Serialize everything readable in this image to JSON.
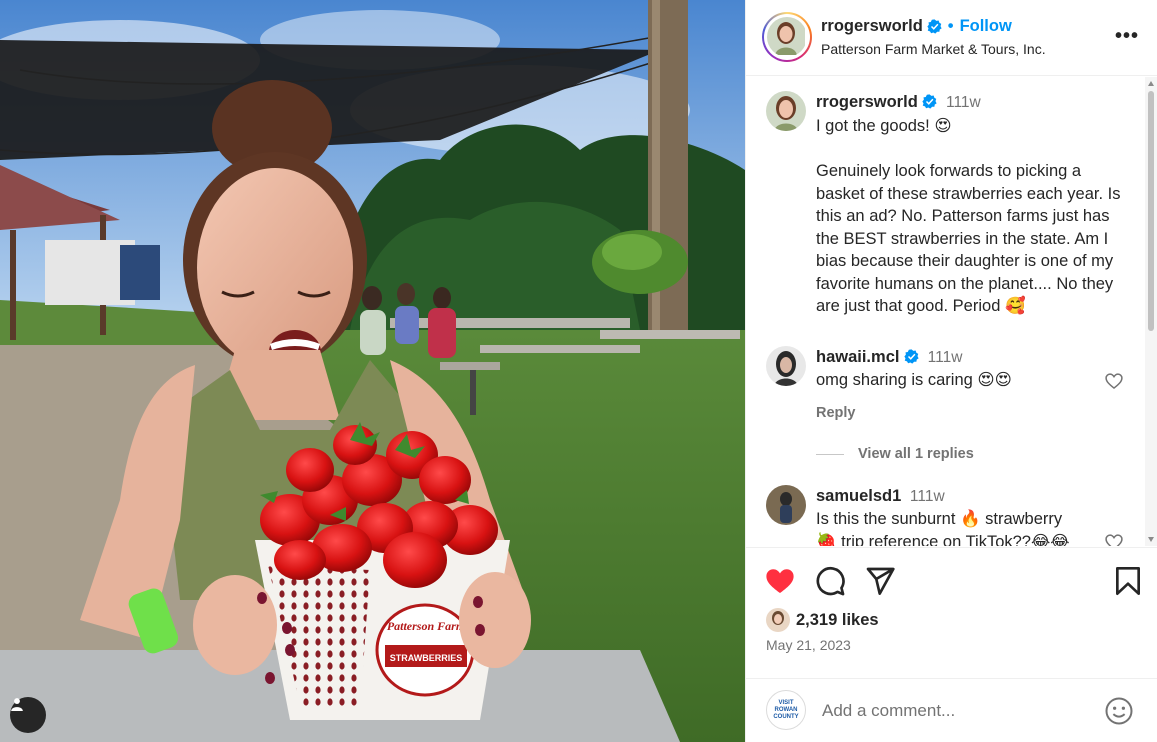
{
  "post": {
    "username": "rrogersworld",
    "location": "Patterson Farm Market & Tours, Inc.",
    "follow_label": "Follow",
    "dot": "•",
    "more_label": "•••"
  },
  "caption": {
    "username": "rrogersworld",
    "time": "111w",
    "text": "I got the goods! 😍\n\nGenuinely look forwards to picking a basket of these strawberries each year. Is this an ad? No. Patterson farms just has the BEST strawberries in the state. Am I bias because their daughter is one of my favorite humans on the planet.... No they are just that good. Period 🥰"
  },
  "comments": [
    {
      "username": "hawaii.mcl",
      "verified": true,
      "time": "111w",
      "text": "omg sharing is caring 😍😍",
      "reply_label": "Reply",
      "view_replies": "View all 1 replies"
    },
    {
      "username": "samuelsd1",
      "verified": false,
      "time": "111w",
      "text": "Is this the sunburnt 🔥 strawberry\n🍓 trip reference on TikTok??😂😂"
    }
  ],
  "stats": {
    "likes": "2,319 likes",
    "date": "May 21, 2023"
  },
  "add_comment": {
    "placeholder": "Add a comment...",
    "avatar_text": "VISIT ROWAN COUNTY"
  },
  "photo": {
    "basket_brand": "Patterson Farm",
    "basket_label": "STRAWBERRIES"
  },
  "colors": {
    "accent": "#0095f6",
    "like_red": "#ff3040",
    "muted": "#737373"
  },
  "icons": [
    "verified-badge-icon",
    "heart-icon",
    "comment-icon",
    "share-icon",
    "bookmark-icon",
    "emoji-icon",
    "more-icon",
    "user-tag-icon"
  ]
}
